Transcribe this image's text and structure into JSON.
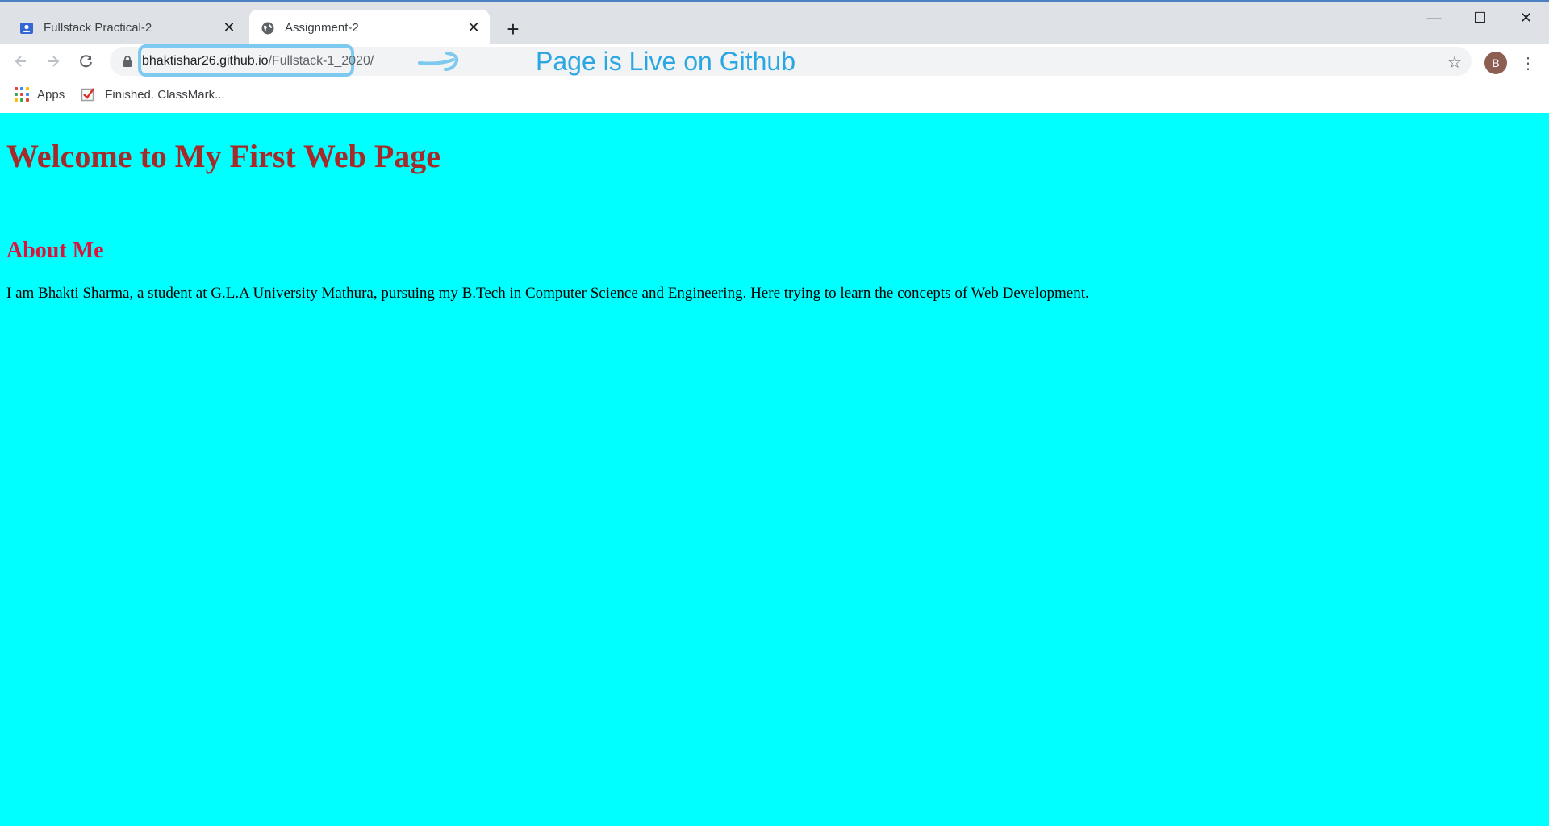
{
  "browser": {
    "tabs": [
      {
        "title": "Fullstack Practical-2",
        "icon": "user-card-icon",
        "active": false
      },
      {
        "title": "Assignment-2",
        "icon": "globe-icon",
        "active": true
      }
    ],
    "window_controls": {
      "minimize": "—",
      "maximize": "☐",
      "close": "✕"
    },
    "address": {
      "domain": "bhaktishar26.github.io",
      "path": "/Fullstack-1_2020/"
    },
    "annotation": "Page is Live on Github",
    "profile_initial": "B",
    "bookmarks": [
      {
        "label": "Apps",
        "icon": "apps-grid-icon"
      },
      {
        "label": "Finished. ClassMark...",
        "icon": "checkbox-icon"
      }
    ]
  },
  "page": {
    "title": "Welcome to My First Web Page",
    "about_heading": "About Me",
    "about_text": "I am Bhakti Sharma, a student at G.L.A University Mathura, pursuing my B.Tech in Computer Science and Engineering. Here trying to learn the concepts of Web Development."
  },
  "colors": {
    "page_background": "#00ffff",
    "title_color": "#a52a2a",
    "heading_color": "#dc143c",
    "annotation_color": "#2aa7e2"
  }
}
